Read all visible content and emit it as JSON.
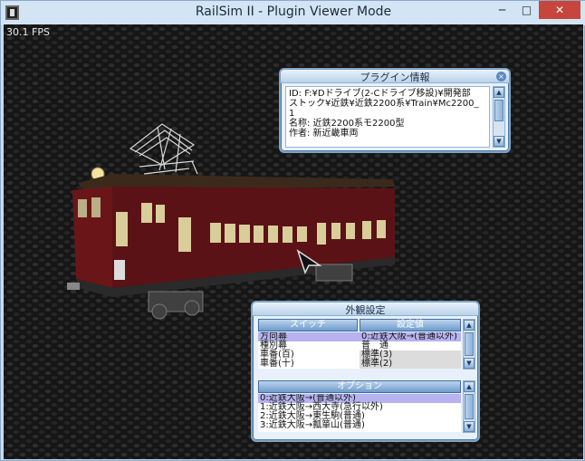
{
  "window": {
    "title": "RailSim II - Plugin Viewer Mode",
    "minimize": "─",
    "maximize": "□",
    "close": "✕"
  },
  "viewport": {
    "fps": "30.1 FPS"
  },
  "plugin_info": {
    "title": "プラグイン情報",
    "lines": [
      "ID: F:¥Dドライブ(2-Cドライブ移設)¥開発部",
      "ストック¥近鉄¥近鉄2200系¥Train¥Mc2200_",
      "1",
      "名称: 近鉄2200系モ2200型",
      "作者: 新近畿車両"
    ]
  },
  "appearance": {
    "title": "外観設定",
    "switch_header": "スイッチ",
    "value_header": "設定値",
    "switches": [
      {
        "key": "方向幕",
        "value": "0:近鉄大阪→(普通以外)"
      },
      {
        "key": "種別幕",
        "value": "普　通"
      },
      {
        "key": "車番(百)",
        "value": "標準(3)"
      },
      {
        "key": "車番(十)",
        "value": "標準(2)"
      }
    ],
    "option_header": "オプション",
    "options": [
      "0:近鉄大阪→(普通以外)",
      "1:近鉄大阪→西大寺(急行以外)",
      "2:近鉄大阪→東生駒(普通)",
      "3:近鉄大阪→瓢箪山(普通)"
    ]
  },
  "colors": {
    "train_body": "#5b1216",
    "highlight": "#b6b3f0"
  }
}
